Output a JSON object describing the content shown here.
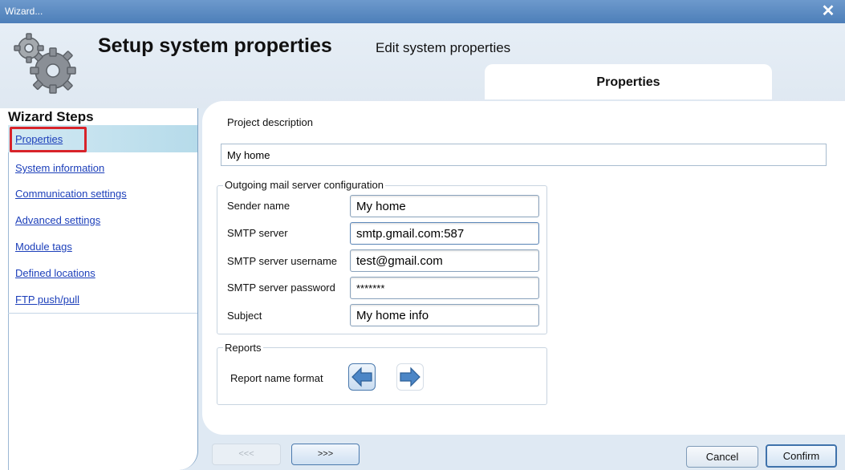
{
  "window": {
    "title": "Wizard..."
  },
  "header": {
    "title": "Setup system properties",
    "subtitle": "Edit system properties",
    "tab": "Properties"
  },
  "steps": {
    "title": "Wizard Steps",
    "items": [
      {
        "label": "Properties",
        "selected": true
      },
      {
        "label": "System information"
      },
      {
        "label": "Communication settings"
      },
      {
        "label": "Advanced settings"
      },
      {
        "label": "Module tags"
      },
      {
        "label": "Defined locations"
      },
      {
        "label": "FTP push/pull"
      }
    ]
  },
  "form": {
    "project_description_label": "Project description",
    "project_description_value": "My home",
    "mail_group_title": "Outgoing mail server configuration",
    "sender_name_label": "Sender name",
    "sender_name_value": "My home",
    "smtp_server_label": "SMTP server",
    "smtp_server_value": "smtp.gmail.com:587",
    "smtp_username_label": "SMTP server  username",
    "smtp_username_value": "test@gmail.com",
    "smtp_password_label": "SMTP server password",
    "smtp_password_value": "*******",
    "subject_label": "Subject",
    "subject_value": "My home info",
    "reports_group_title": "Reports",
    "report_name_format_label": "Report name format"
  },
  "footer": {
    "back_label": "<<<",
    "next_label": ">>>",
    "cancel_label": "Cancel",
    "confirm_label": "Confirm"
  },
  "colors": {
    "title_bar": "#5b8ac3",
    "link": "#1c3fba",
    "selection_highlight": "#c4e2ef",
    "annotation_red": "#d8232a",
    "arrow_blue": "#4c86c6"
  },
  "icons": {
    "logo": "gears-icon",
    "close": "close-icon",
    "report_format_left": "arrow-left-icon",
    "report_format_right": "arrow-right-icon"
  }
}
